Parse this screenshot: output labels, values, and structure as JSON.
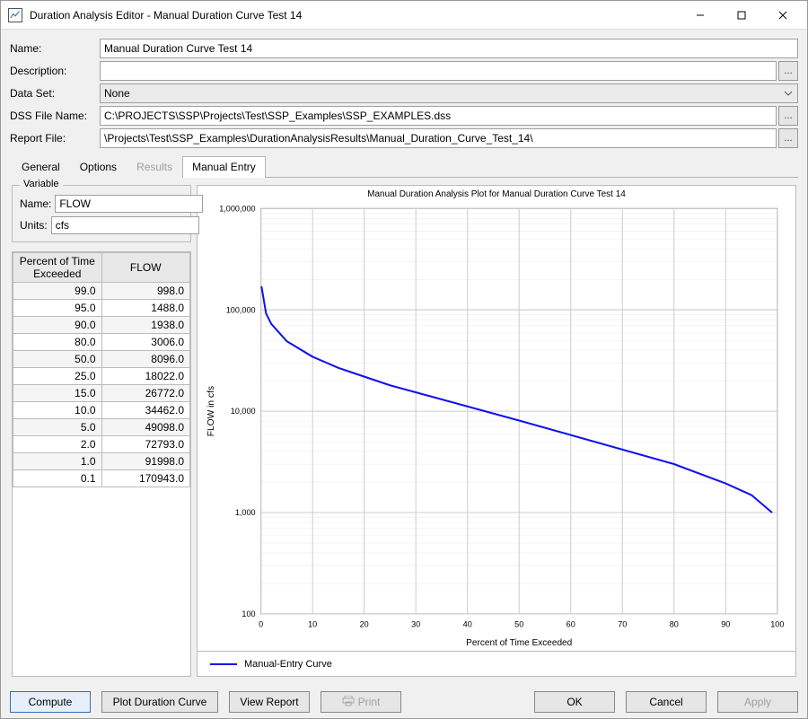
{
  "window": {
    "title": "Duration Analysis Editor - Manual Duration Curve Test 14"
  },
  "form": {
    "name_label": "Name:",
    "name_value": "Manual Duration Curve Test 14",
    "desc_label": "Description:",
    "desc_value": "",
    "dataset_label": "Data Set:",
    "dataset_value": "None",
    "dssfile_label": "DSS File Name:",
    "dssfile_value": "C:\\PROJECTS\\SSP\\Projects\\Test\\SSP_Examples\\SSP_EXAMPLES.dss",
    "report_label": "Report File:",
    "report_value": "\\Projects\\Test\\SSP_Examples\\DurationAnalysisResults\\Manual_Duration_Curve_Test_14\\"
  },
  "tabs": {
    "general": "General",
    "options": "Options",
    "results": "Results",
    "manual": "Manual Entry"
  },
  "variable": {
    "legend": "Variable",
    "name_label": "Name:",
    "name_value": "FLOW",
    "units_label": "Units:",
    "units_value": "cfs"
  },
  "table": {
    "col_percent": "Percent of Time Exceeded",
    "col_flow": "FLOW",
    "rows": [
      {
        "p": "99.0",
        "v": "998.0"
      },
      {
        "p": "95.0",
        "v": "1488.0"
      },
      {
        "p": "90.0",
        "v": "1938.0"
      },
      {
        "p": "80.0",
        "v": "3006.0"
      },
      {
        "p": "50.0",
        "v": "8096.0"
      },
      {
        "p": "25.0",
        "v": "18022.0"
      },
      {
        "p": "15.0",
        "v": "26772.0"
      },
      {
        "p": "10.0",
        "v": "34462.0"
      },
      {
        "p": "5.0",
        "v": "49098.0"
      },
      {
        "p": "2.0",
        "v": "72793.0"
      },
      {
        "p": "1.0",
        "v": "91998.0"
      },
      {
        "p": "0.1",
        "v": "170943.0"
      }
    ]
  },
  "chart": {
    "title": "Manual Duration Analysis Plot for Manual Duration Curve Test 14",
    "xlabel": "Percent of Time Exceeded",
    "ylabel": "FLOW in cfs",
    "legend": "Manual-Entry Curve",
    "yticks": [
      "100",
      "1,000",
      "10,000",
      "100,000",
      "1,000,000"
    ],
    "xticks": [
      "0",
      "10",
      "20",
      "30",
      "40",
      "50",
      "60",
      "70",
      "80",
      "90",
      "100"
    ]
  },
  "chart_data": {
    "type": "line",
    "xlabel": "Percent of Time Exceeded",
    "ylabel": "FLOW in cfs",
    "xlim": [
      0,
      100
    ],
    "ylim": [
      100,
      1000000
    ],
    "yscale": "log",
    "series": [
      {
        "name": "Manual-Entry Curve",
        "color": "#1111ee",
        "x": [
          0.1,
          1.0,
          2.0,
          5.0,
          10.0,
          15.0,
          25.0,
          50.0,
          80.0,
          90.0,
          95.0,
          99.0
        ],
        "y": [
          170943.0,
          91998.0,
          72793.0,
          49098.0,
          34462.0,
          26772.0,
          18022.0,
          8096.0,
          3006.0,
          1938.0,
          1488.0,
          998.0
        ]
      }
    ]
  },
  "buttons": {
    "compute": "Compute",
    "plot": "Plot Duration Curve",
    "view": "View Report",
    "print": "Print",
    "ok": "OK",
    "cancel": "Cancel",
    "apply": "Apply"
  },
  "ellipsis": "..."
}
